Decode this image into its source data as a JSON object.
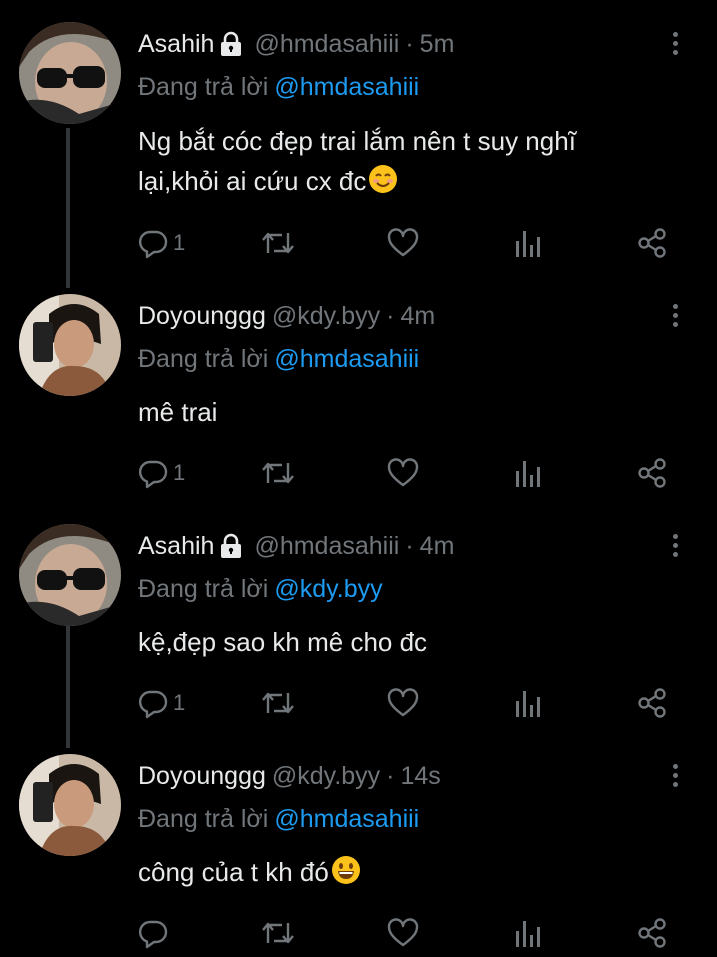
{
  "thread": {
    "tweets": [
      {
        "name": "Asahih",
        "locked": true,
        "handle": "@hmdasahiii",
        "separator": "·",
        "time": "5m",
        "reply_prefix": "Đang trả lời",
        "reply_to": "@hmdasahiii",
        "text_line1": "Ng bắt cóc đẹp trai lắm nên t suy nghĩ",
        "text_line2": "lại,khỏi ai cứu cx đc",
        "emoji": "smiling-face-emoji",
        "reply_count": "1"
      },
      {
        "name": "Doyounggg",
        "locked": false,
        "handle": "@kdy.byy",
        "separator": "·",
        "time": "4m",
        "reply_prefix": "Đang trả lời",
        "reply_to": "@hmdasahiii",
        "text_line1": "mê trai",
        "reply_count": "1"
      },
      {
        "name": "Asahih",
        "locked": true,
        "handle": "@hmdasahiii",
        "separator": "·",
        "time": "4m",
        "reply_prefix": "Đang trả lời",
        "reply_to": "@kdy.byy",
        "text_line1": "kệ,đẹp sao kh mê cho đc",
        "reply_count": "1"
      },
      {
        "name": "Doyounggg",
        "locked": false,
        "handle": "@kdy.byy",
        "separator": "·",
        "time": "14s",
        "reply_prefix": "Đang trả lời",
        "reply_to": "@hmdasahiii",
        "text_line1": "công của t kh đó",
        "emoji": "grinning-face-emoji",
        "reply_count": ""
      }
    ]
  },
  "colors": {
    "background": "#000000",
    "text": "#e7e9ea",
    "secondary": "#71767b",
    "link": "#1d9bf0",
    "thread_line": "#333639"
  },
  "icons": {
    "lock": "lock-icon",
    "more": "more-vertical-icon",
    "reply": "reply-icon",
    "retweet": "retweet-icon",
    "like": "heart-icon",
    "views": "analytics-icon",
    "share": "share-icon"
  }
}
